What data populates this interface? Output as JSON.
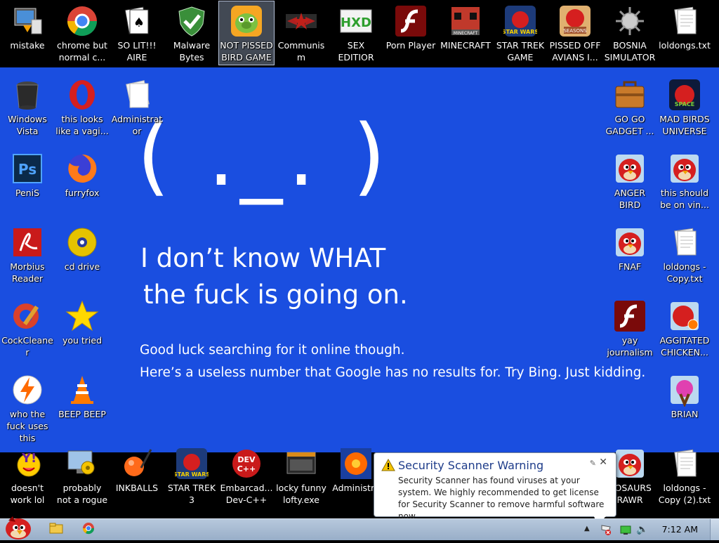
{
  "desktop_icons": [
    {
      "label": "mistake",
      "icon": "computer-install-icon"
    },
    {
      "label": "chrome but normal c...",
      "icon": "chrome-icon"
    },
    {
      "label": "SO LIT!!! AIRE",
      "icon": "solitaire-cards-icon"
    },
    {
      "label": "Malware Bytes",
      "icon": "shield-check-icon"
    },
    {
      "label": "NOT PISSED BIRD GAME",
      "icon": "green-pig-game-icon"
    },
    {
      "label": "Communism",
      "icon": "star-emblem-icon"
    },
    {
      "label": "SEX EDITIOR",
      "icon": "hxd-editor-icon"
    },
    {
      "label": "Porn Player",
      "icon": "flash-player-icon"
    },
    {
      "label": "MINECRAFT",
      "icon": "minecraft-icon"
    },
    {
      "label": "STAR TREK GAME",
      "icon": "star-wars-birds-icon"
    },
    {
      "label": "PISSED OFF AVIANS I...",
      "icon": "angry-birds-seasons-icon"
    },
    {
      "label": "BOSNIA SIMULATOR",
      "icon": "spiked-ball-icon"
    },
    {
      "label": "loldongs.txt",
      "icon": "text-document-icon"
    },
    {
      "label": "Windows Vista",
      "icon": "trash-bin-icon"
    },
    {
      "label": "this looks like a vagi...",
      "icon": "opera-icon"
    },
    {
      "label": "Administrator",
      "icon": "blank-document-icon"
    },
    {
      "label": "PeniS",
      "icon": "photoshop-icon"
    },
    {
      "label": "furryfox",
      "icon": "firefox-icon"
    },
    {
      "label": "Morbius Reader",
      "icon": "pdf-reader-icon"
    },
    {
      "label": "cd drive",
      "icon": "cd-drive-icon"
    },
    {
      "label": "CockCleaner",
      "icon": "ccleaner-icon"
    },
    {
      "label": "you tried",
      "icon": "gold-star-icon"
    },
    {
      "label": "who the fuck uses this",
      "icon": "bolt-circle-icon"
    },
    {
      "label": "BEEP BEEP",
      "icon": "traffic-cone-icon"
    },
    {
      "label": "doesn't work lol",
      "icon": "yahoo-messenger-icon"
    },
    {
      "label": "probably not a rogue",
      "icon": "monitor-gears-icon"
    },
    {
      "label": "INKBALLS",
      "icon": "inkball-icon"
    },
    {
      "label": "STAR TREK 3",
      "icon": "star-wars-birds-icon"
    },
    {
      "label": "Embarcad... Dev-C++",
      "icon": "dev-cpp-icon"
    },
    {
      "label": "locky funny lofty.exe",
      "icon": "program-window-icon"
    },
    {
      "label": "Administra",
      "icon": "orange-flower-icon"
    },
    {
      "label": "GO GO GADGET ...",
      "icon": "briefcase-icon"
    },
    {
      "label": "MAD BIRDS UNIVERSE",
      "icon": "angry-birds-space-icon"
    },
    {
      "label": "ANGER BIRD",
      "icon": "red-bird-icon"
    },
    {
      "label": "this should be on vin...",
      "icon": "red-bird-icon"
    },
    {
      "label": "FNAF",
      "icon": "red-bird-icon"
    },
    {
      "label": "loldongs - Copy.txt",
      "icon": "text-document-icon"
    },
    {
      "label": "yay journalism",
      "icon": "flash-player-icon"
    },
    {
      "label": "AGGITATED CHICKEN...",
      "icon": "red-bird-badge-icon"
    },
    {
      "label": "BRIAN",
      "icon": "slingshot-bird-icon"
    },
    {
      "label": "NOSAURS RAWR",
      "icon": "red-bird-icon"
    },
    {
      "label": "loldongs - Copy (2).txt",
      "icon": "text-document-icon"
    }
  ],
  "bsod": {
    "frown": "( ._. )",
    "line1": "I don’t know WHAT",
    "line2": "the fuck is going on.",
    "line3": "Good luck searching for it online though.",
    "line4": "Here’s a useless number that Google has no results for. Try Bing. Just kidding."
  },
  "notification": {
    "title": "Security Scanner Warning",
    "body": "Security Scanner has found viruses at your system. We highly recommended to get license for Security Scanner to remove harmful software now."
  },
  "taskbar": {
    "start_icon": "red-bird-start-icon",
    "pinned": [
      "explorer-folder-icon",
      "chrome-icon"
    ],
    "tray_icons": [
      "show-hidden-arrow-icon",
      "security-flag-icon",
      "network-icon",
      "volume-icon"
    ],
    "clock": "7:12 AM"
  },
  "colors": {
    "desktop_blue": "#1a4ee0",
    "band_black": "#000000",
    "taskbar": "#a9bdd4"
  }
}
